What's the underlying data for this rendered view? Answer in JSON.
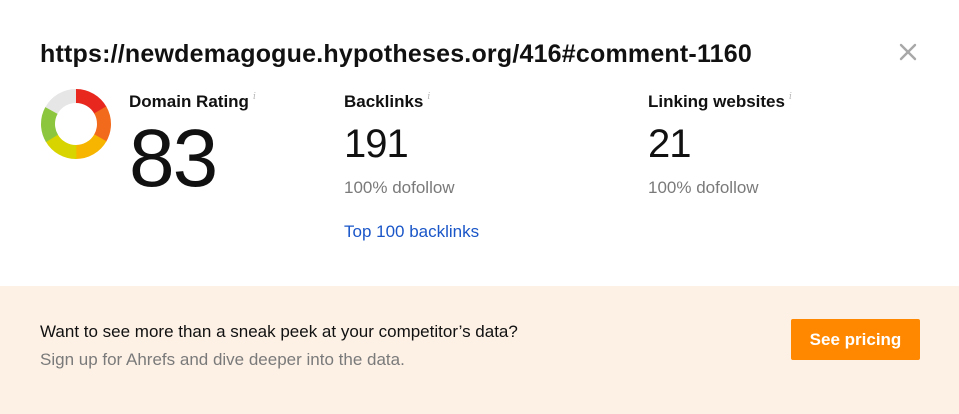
{
  "url": "https://newdemagogue.hypotheses.org/416#comment-1160",
  "close_icon": "close-icon",
  "info_icon_glyph": "i",
  "domain_rating": {
    "label": "Domain Rating",
    "value": "83",
    "gauge_fraction": 0.83,
    "gauge_colors": [
      "#e8281f",
      "#f26b1d",
      "#f7b500",
      "#d7d400",
      "#8cc63f"
    ],
    "gauge_track_color": "#e6e6e6"
  },
  "backlinks": {
    "label": "Backlinks",
    "value": "191",
    "sub": "100% dofollow",
    "link": "Top 100 backlinks"
  },
  "linking_websites": {
    "label": "Linking websites",
    "value": "21",
    "sub": "100% dofollow"
  },
  "promo": {
    "title": "Want to see more than a sneak peek at your competitor’s data?",
    "subtitle": "Sign up for Ahrefs and dive deeper into the data.",
    "button": "See pricing"
  },
  "colors": {
    "accent_orange": "#ff8800",
    "link_blue": "#1a56c8",
    "promo_bg": "#fdf1e6"
  }
}
